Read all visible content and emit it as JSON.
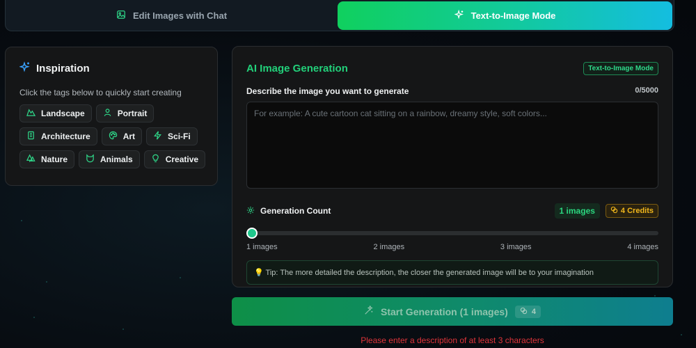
{
  "mode_bar": {
    "tabs": [
      {
        "label": "Edit Images with Chat",
        "icon": "image-icon",
        "active": false
      },
      {
        "label": "Text-to-Image Mode",
        "icon": "sparkle-icon",
        "active": true
      }
    ]
  },
  "inspiration": {
    "title": "Inspiration",
    "subtitle": "Click the tags below to quickly start creating",
    "tags": [
      {
        "label": "Landscape",
        "icon": "mountain-icon"
      },
      {
        "label": "Portrait",
        "icon": "user-icon"
      },
      {
        "label": "Architecture",
        "icon": "building-icon"
      },
      {
        "label": "Art",
        "icon": "palette-icon"
      },
      {
        "label": "Sci-Fi",
        "icon": "bolt-icon"
      },
      {
        "label": "Nature",
        "icon": "tree-icon"
      },
      {
        "label": "Animals",
        "icon": "cat-icon"
      },
      {
        "label": "Creative",
        "icon": "bulb-icon"
      }
    ]
  },
  "generation": {
    "title": "AI Image Generation",
    "mode_badge": "Text-to-Image Mode",
    "describe_label": "Describe the image you want to generate",
    "char_count": "0/5000",
    "prompt_value": "",
    "prompt_placeholder": "For example: A cute cartoon cat sitting on a rainbow, dreamy style, soft colors...",
    "count_label": "Generation Count",
    "images_badge": "1 images",
    "credits_badge": "4 Credits",
    "slider": {
      "value": 1,
      "min": 1,
      "max": 4
    },
    "ticks": [
      "1 images",
      "2 images",
      "3 images",
      "4 images"
    ],
    "tip": "💡 Tip: The more detailed the description, the closer the generated image will be to your imagination"
  },
  "start_button": {
    "label": "Start Generation (1 images)",
    "cost": "4"
  },
  "error": "Please enter a description of at least 3 characters",
  "colors": {
    "accent_green": "#22d07a",
    "accent_cyan": "#14bde0",
    "credit_gold": "#f1b71c",
    "error_red": "#e0343a"
  }
}
